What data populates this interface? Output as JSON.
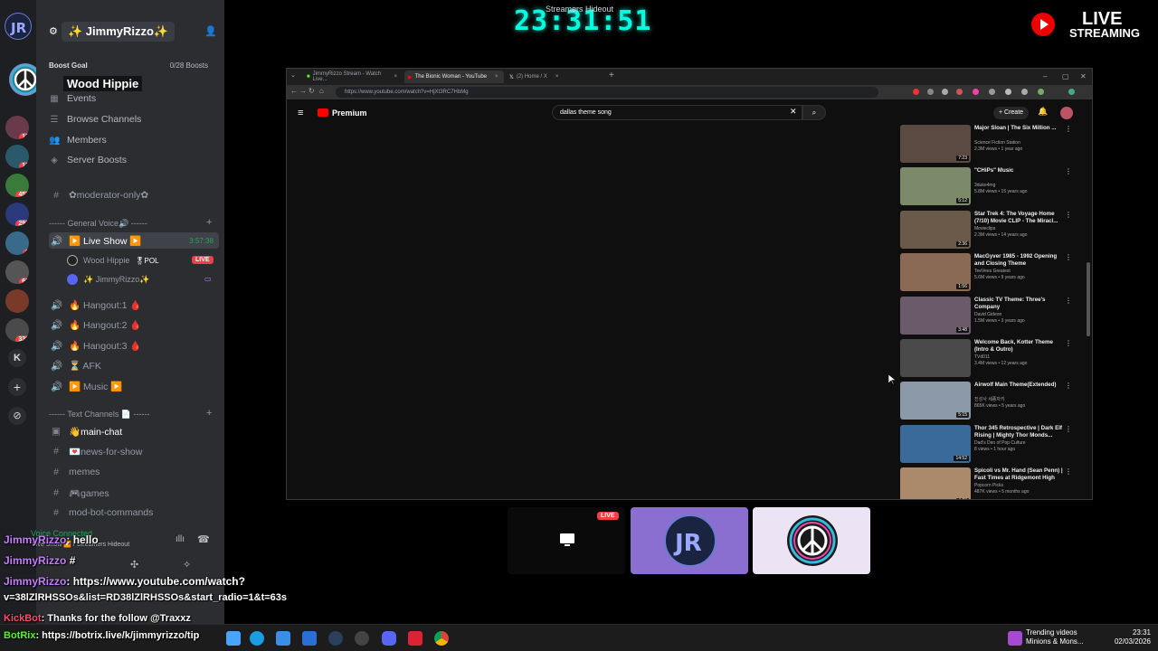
{
  "overlay": {
    "clock": "23:31:51",
    "clock_subtitle": "Streamers Hideout",
    "live_line1": "LIVE",
    "live_line2": "STREAMING"
  },
  "rail": {
    "badges": [
      "15",
      "13",
      "455",
      "291",
      "9",
      "62",
      "330"
    ]
  },
  "sidebar": {
    "server_name": "✨ JimmyRizzo✨",
    "boost_label": "Boost Goal",
    "boost_count": "0/28 Boosts",
    "hover_user": "Wood Hippie",
    "nav": [
      {
        "label": "Events",
        "icon": "calendar-icon"
      },
      {
        "label": "Browse Channels",
        "icon": "list-icon"
      },
      {
        "label": "Members",
        "icon": "members-icon"
      },
      {
        "label": "Server Boosts",
        "icon": "boost-icon"
      }
    ],
    "mod_channel": "✿moderator-only✿",
    "voice_category": "------ General Voice🔊 ------",
    "live_show": {
      "label": "▶️ Live Show ▶️",
      "timer": "3:57:38"
    },
    "voice_users": [
      {
        "name": "Wood Hippie",
        "tag": "🎖POL",
        "live": "LIVE"
      },
      {
        "name": "✨ JimmyRizzo✨"
      }
    ],
    "voice_channels": [
      "🔥 Hangout:1 🩸",
      "🔥 Hangout:2 🩸",
      "🔥 Hangout:3 🩸",
      "⏳ AFK",
      "▶️ Music ▶️"
    ],
    "text_category": "------ Text Channels 📄 ------",
    "text_channels": [
      "👋main-chat",
      "💌news-for-show",
      "memes",
      "🎮games",
      "mod-bot-commands"
    ],
    "voice_connected": "Voice Connected",
    "voice_connected_sub": "Live Show ▶️ / Streamers Hideout"
  },
  "chat": [
    {
      "user": "JimmyRizzo",
      "text": ": hello"
    },
    {
      "user": "JimmyRizzo",
      "text": " #"
    },
    {
      "user": "JimmyRizzo",
      "text": ": https://www.youtube.com/watch?"
    },
    {
      "user": "",
      "text": "v=38lZlRHSSOs&list=RD38lZlRHSSOs&start_radio=1&t=63s"
    },
    {
      "user": "KickBot",
      "text": ": Thanks for the follow @Traxxz"
    },
    {
      "user": "BotRix",
      "text": ": https://botrix.live/k/jimmyrizzo/tip"
    }
  ],
  "browser": {
    "tabs": [
      "JimmyRizzo Stream - Watch Live...",
      "The Bionic Woman - YouTube",
      "(2) Home / X"
    ],
    "url": "https://www.youtube.com/watch?v=HjXt3RC7HbMg",
    "brand": "Premium",
    "search": "dallas theme song",
    "create": "+ Create",
    "recommendations": [
      {
        "title": "Major Sloan | The Six Million ...",
        "channel": "Science Fiction Station",
        "meta": "2.3M views • 1 year ago",
        "duration": "7:23",
        "color": "#5a4a42"
      },
      {
        "title": "\"CHiPs\" Music",
        "channel": "3duke4mg",
        "meta": "5.8M views • 15 years ago",
        "duration": "5:12",
        "color": "#7c8a6a"
      },
      {
        "title": "Star Trek 4: The Voyage Home (7/10) Movie CLIP - The Miracl...",
        "channel": "Movieclips",
        "meta": "2.3M views • 14 years ago",
        "duration": "2:36",
        "color": "#6b5a4a"
      },
      {
        "title": "MacGyver 1985 - 1992 Opening and Closing Theme",
        "channel": "TeeVees Greatest",
        "meta": "5.6M views • 9 years ago",
        "duration": "1:56",
        "color": "#8a6a55"
      },
      {
        "title": "Classic TV Theme: Three's Company",
        "channel": "David Gideon",
        "meta": "1.5M views • 3 years ago",
        "duration": "3:48",
        "color": "#6a5a6a"
      },
      {
        "title": "Welcome Back, Kotter Theme (Intro & Outro)",
        "channel": "TVd011",
        "meta": "3.4M views • 12 years ago",
        "duration": "",
        "color": "#4a4a4a"
      },
      {
        "title": "Airwolf Main Theme(Extended)",
        "channel": "진성사 세종차키",
        "meta": "865K views • 5 years ago",
        "duration": "5:15",
        "color": "#8a98a8"
      },
      {
        "title": "Thor 345 Retrospective | Dark Elf Rising | Mighty Thor Monds...",
        "channel": "Dad's Den of Pop Culture",
        "meta": "8 views • 1 hour ago",
        "duration": "14:52",
        "color": "#3a6a9a"
      },
      {
        "title": "Spicoli vs Mr. Hand (Sean Penn) | Fast Times at Ridgemont High",
        "channel": "Popcorn Picks",
        "meta": "487K views • 5 months ago",
        "duration": "4:29",
        "color": "#aa8a6a"
      }
    ]
  },
  "tiles": {
    "live": "LIVE"
  },
  "taskbar": {
    "trending_line1": "Trending videos",
    "trending_line2": "Minions & Mons...",
    "time": "23:31",
    "date": "02/03/2026"
  }
}
